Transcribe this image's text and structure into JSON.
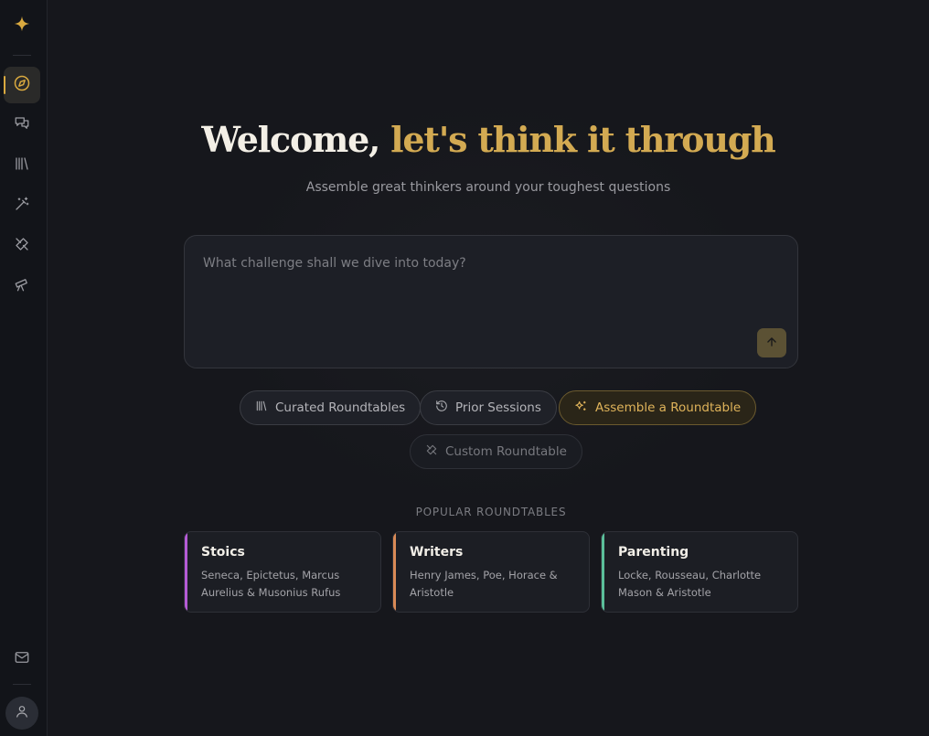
{
  "colors": {
    "accent": "#d3aa52",
    "background": "#16171c",
    "sidebar": "#121419",
    "card_stoics": "#b55bd6",
    "card_writers": "#d98a56",
    "card_parenting": "#5bbf9a"
  },
  "sidebar": {
    "logo": "sparkle-icon",
    "items": [
      {
        "name": "explore",
        "icon": "compass-icon",
        "active": true
      },
      {
        "name": "chats",
        "icon": "chat-bubbles-icon"
      },
      {
        "name": "library",
        "icon": "library-icon"
      },
      {
        "name": "create",
        "icon": "magic-wand-icon"
      },
      {
        "name": "tools",
        "icon": "tools-icon"
      },
      {
        "name": "discover",
        "icon": "telescope-icon"
      }
    ],
    "bottom": [
      {
        "name": "messages",
        "icon": "mail-icon"
      },
      {
        "name": "profile",
        "icon": "user-icon"
      }
    ]
  },
  "hero": {
    "title_main": "Welcome,",
    "title_accent": "let's think it through",
    "subtitle": "Assemble great thinkers around your toughest questions"
  },
  "prompt": {
    "placeholder": "What challenge shall we dive into today?",
    "value": ""
  },
  "actions": {
    "curated": "Curated Roundtables",
    "prior": "Prior Sessions",
    "assemble": "Assemble a Roundtable",
    "custom": "Custom Roundtable"
  },
  "popular": {
    "label": "POPULAR ROUNDTABLES",
    "cards": [
      {
        "title": "Stoics",
        "desc": "Seneca, Epictetus, Marcus Aurelius & Musonius Rufus"
      },
      {
        "title": "Writers",
        "desc": "Henry James, Poe, Horace & Aristotle"
      },
      {
        "title": "Parenting",
        "desc": "Locke, Rousseau, Charlotte Mason & Aristotle"
      }
    ]
  }
}
